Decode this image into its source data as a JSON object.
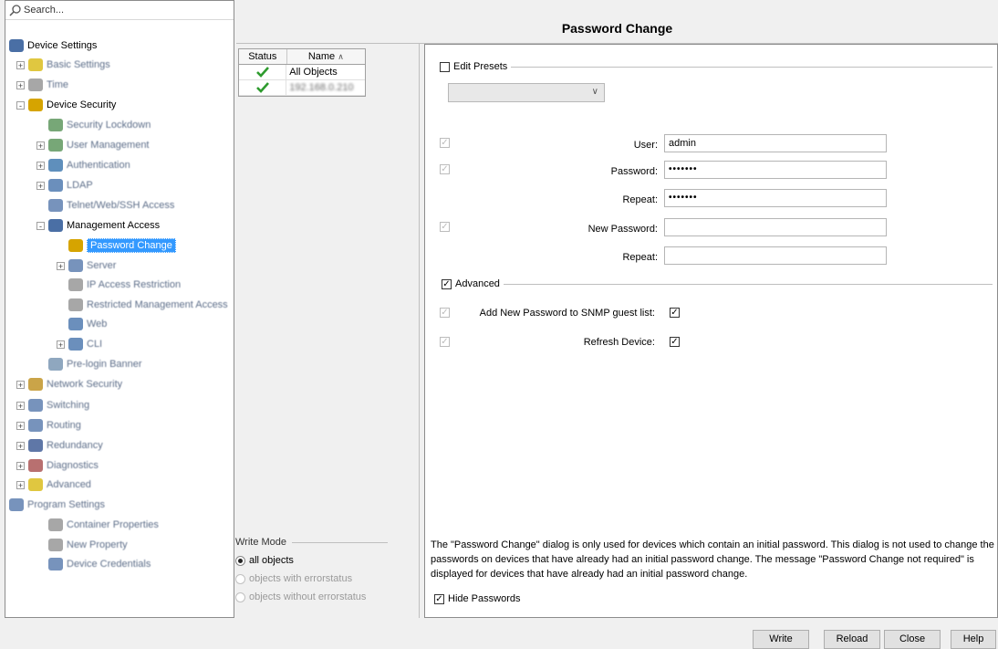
{
  "search": {
    "label": "Search..."
  },
  "tree": {
    "root": "Device Settings",
    "items": [
      "Basic Settings",
      "Time",
      "Device Security",
      "Security Lockdown",
      "User Management",
      "Authentication",
      "LDAP",
      "Telnet/Web/SSH Access",
      "Management Access",
      "Password Change",
      "Server",
      "IP Access Restriction",
      "Restricted Management Access",
      "Web",
      "CLI",
      "Pre-login Banner",
      "Network Security",
      "Switching",
      "Routing",
      "Redundancy",
      "Diagnostics",
      "Advanced",
      "Program Settings",
      "Container Properties",
      "New Property",
      "Device Credentials"
    ]
  },
  "title": "Password Change",
  "table": {
    "col_status": "Status",
    "col_name": "Name",
    "sort_icon": "sort-ascending-icon",
    "rows": [
      {
        "name": "All Objects"
      },
      {
        "name": "192.168.0.210"
      }
    ]
  },
  "write_mode": {
    "legend": "Write Mode",
    "options": [
      "all objects",
      "objects with errorstatus",
      "objects without errorstatus"
    ]
  },
  "form": {
    "edit_presets": "Edit Presets",
    "user_label": "User:",
    "user_value": "admin",
    "password_label": "Password:",
    "password_value": "•••••••",
    "repeat_label": "Repeat:",
    "repeat_value": "•••••••",
    "new_password_label": "New Password:",
    "new_password_value": "",
    "repeat2_label": "Repeat:",
    "repeat2_value": "",
    "advanced": "Advanced",
    "snmp_label": "Add New Password to SNMP guest list:",
    "refresh_label": "Refresh Device:",
    "note": "The \"Password Change\" dialog is only used for devices which contain an initial password. This dialog is not used to change the passwords on devices that have already had an initial password change. The message \"Password Change not required\" is displayed for devices that have already had an initial password change.",
    "hide_passwords": "Hide Passwords"
  },
  "buttons": {
    "write": "Write",
    "reload": "Reload",
    "close": "Close",
    "help": "Help"
  },
  "colors": {
    "selection": "#3399ff",
    "check_green": "#2e9b2e"
  }
}
